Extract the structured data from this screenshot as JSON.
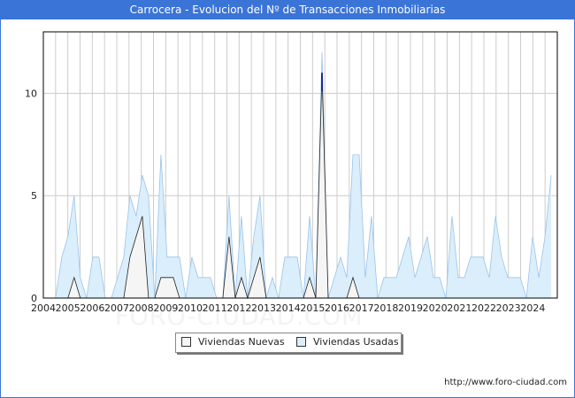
{
  "header": {
    "title": "Carrocera - Evolucion del Nº de Transacciones Inmobiliarias"
  },
  "watermark": "FORO-CIUDAD.COM",
  "footer": {
    "url": "http://www.foro-ciudad.com"
  },
  "legend": {
    "nuevas": "Viviendas Nuevas",
    "usadas": "Viviendas Usadas"
  },
  "colors": {
    "nuevas_fill": "#f5f5f5",
    "nuevas_line": "#222222",
    "usadas_fill": "#dbeefb",
    "usadas_line": "#9bc3ea",
    "grid": "#cccccc",
    "title_bg": "#3b74d7"
  },
  "chart_data": {
    "type": "area",
    "x_ticks": [
      "2004",
      "2005",
      "2006",
      "2007",
      "2008",
      "2009",
      "2010",
      "2011",
      "2012",
      "2013",
      "2014",
      "2015",
      "2016",
      "2017",
      "2018",
      "2019",
      "2020",
      "2021",
      "2022",
      "2023",
      "2024"
    ],
    "y_ticks": [
      0,
      5,
      10
    ],
    "ylim": [
      0,
      13
    ],
    "grid": true,
    "legend_position": "bottom-center",
    "x_start": 2004,
    "series": [
      {
        "name": "Viviendas Usadas",
        "quarters": [
          "2004Q3",
          "2024Q4"
        ],
        "values": [
          0,
          2,
          3,
          5,
          1,
          0,
          2,
          2,
          0,
          0,
          1,
          2,
          5,
          4,
          6,
          5,
          0,
          7,
          2,
          2,
          2,
          0,
          2,
          1,
          1,
          1,
          0,
          0,
          5,
          0,
          4,
          0,
          3,
          5,
          0,
          1,
          0,
          2,
          2,
          2,
          0,
          4,
          0,
          12,
          0,
          1,
          2,
          1,
          7,
          7,
          1,
          4,
          0,
          1,
          1,
          1,
          2,
          3,
          1,
          2,
          3,
          1,
          1,
          0,
          4,
          1,
          1,
          2,
          2,
          2,
          1,
          4,
          2,
          1,
          1,
          1,
          0,
          3,
          1,
          3,
          6
        ]
      },
      {
        "name": "Viviendas Nuevas",
        "quarters": [
          "2004Q3",
          "2024Q4"
        ],
        "values": [
          0,
          0,
          0,
          1,
          0,
          0,
          0,
          0,
          0,
          0,
          0,
          0,
          2,
          3,
          4,
          0,
          0,
          1,
          1,
          1,
          0,
          0,
          0,
          0,
          0,
          0,
          0,
          0,
          3,
          0,
          1,
          0,
          1,
          2,
          0,
          0,
          0,
          0,
          0,
          0,
          0,
          1,
          0,
          11,
          0,
          0,
          0,
          0,
          1,
          0,
          0,
          0,
          0,
          0,
          0,
          0,
          0,
          0,
          0,
          0,
          0,
          0,
          0,
          0,
          0,
          0,
          0,
          0,
          0,
          0,
          0,
          0,
          0,
          0,
          0,
          0,
          0,
          0,
          0,
          0,
          0
        ]
      }
    ]
  }
}
